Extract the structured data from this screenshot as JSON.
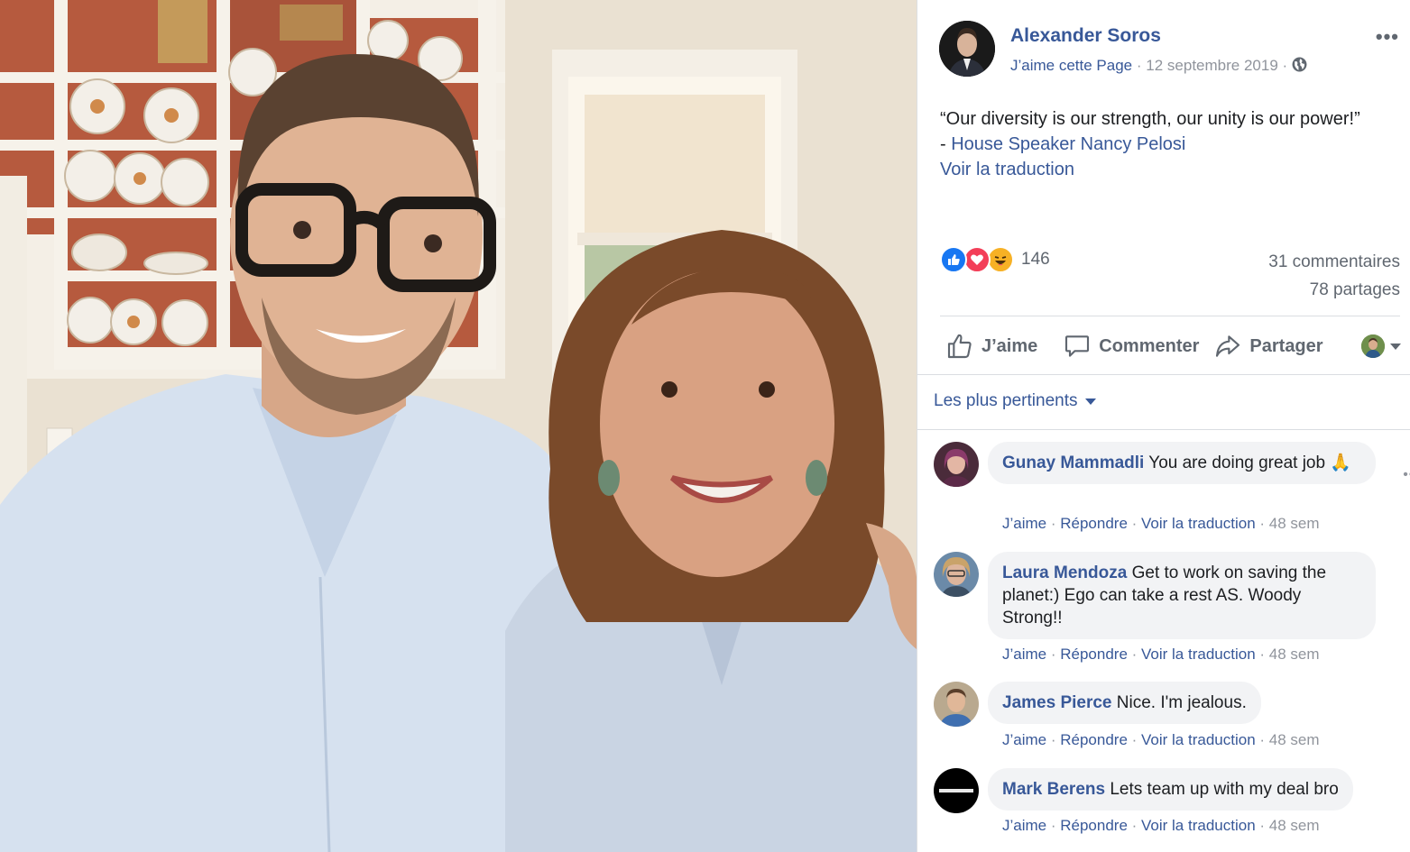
{
  "post": {
    "author": "Alexander Soros",
    "like_page": "J’aime cette Page",
    "separator": "·",
    "date": "12 septembre 2019",
    "more_label": "•••",
    "text_line1": "“Our diversity is our strength, our unity is our power!”",
    "text_dash": "- ",
    "text_link": "House Speaker Nancy Pelosi",
    "translate": "Voir la traduction"
  },
  "stats": {
    "reactions_count": "146",
    "comments": "31 commentaires",
    "shares": "78 partages"
  },
  "actions": {
    "like": "J’aime",
    "comment": "Commenter",
    "share": "Partager"
  },
  "sort_label": "Les plus pertinents",
  "comments": [
    {
      "name": "Gunay Mammadli",
      "text": "You are doing great job 🙏",
      "like": "J’aime",
      "reply": "Répondre",
      "translate": "Voir la traduction",
      "time": "48 sem"
    },
    {
      "name": "Laura Mendoza",
      "text": "Get to work on saving the planet:) Ego can take a rest AS. Woody Strong!!",
      "like": "J’aime",
      "reply": "Répondre",
      "translate": "Voir la traduction",
      "time": "48 sem"
    },
    {
      "name": "James Pierce",
      "text": "Nice. I'm jealous.",
      "like": "J’aime",
      "reply": "Répondre",
      "translate": "Voir la traduction",
      "time": "48 sem"
    },
    {
      "name": "Mark Berens",
      "text": "Lets team up with my deal bro",
      "like": "J’aime",
      "reply": "Répondre",
      "translate": "Voir la traduction",
      "time": "48 sem"
    }
  ],
  "colors": {
    "link": "#385898",
    "muted": "#90949c",
    "bubble": "#f2f3f5",
    "like_blue": "#1877f2",
    "love_red": "#f33e58",
    "haha_yellow": "#f7b125"
  },
  "icons": [
    "globe-icon",
    "like-reaction-icon",
    "love-reaction-icon",
    "haha-reaction-icon",
    "thumbs-up-icon",
    "comment-icon",
    "share-icon",
    "chevron-down-icon",
    "more-icon"
  ]
}
